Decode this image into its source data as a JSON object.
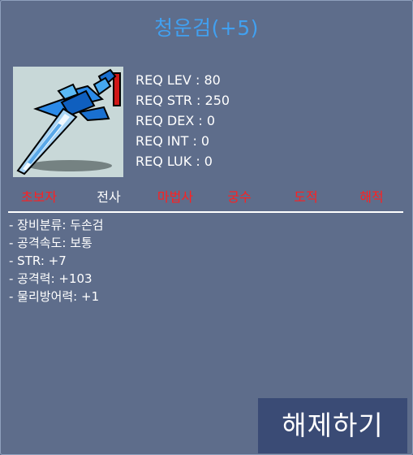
{
  "item": {
    "name": "청운검(+5)",
    "icon": "blue-sword-icon",
    "title_color": "#41a0f0"
  },
  "requirements": [
    {
      "text": "REQ LEV : 80"
    },
    {
      "text": "REQ STR : 250"
    },
    {
      "text": "REQ DEX : 0"
    },
    {
      "text": "REQ INT : 0"
    },
    {
      "text": "REQ LUK : 0"
    }
  ],
  "jobs": [
    {
      "label": "초보자",
      "color": "#ff2020"
    },
    {
      "label": "전사",
      "color": "#ffffff"
    },
    {
      "label": "마법사",
      "color": "#ff2020"
    },
    {
      "label": "궁수",
      "color": "#ff2020"
    },
    {
      "label": "도적",
      "color": "#ff2020"
    },
    {
      "label": "해적",
      "color": "#ff2020"
    }
  ],
  "stats": [
    {
      "text": "- 장비분류: 두손검"
    },
    {
      "text": "- 공격속도: 보통"
    },
    {
      "text": "- STR: +7"
    },
    {
      "text": "- 공격력: +103"
    },
    {
      "text": "- 물리방어력: +1"
    }
  ],
  "actions": {
    "unequip_label": "해제하기"
  }
}
